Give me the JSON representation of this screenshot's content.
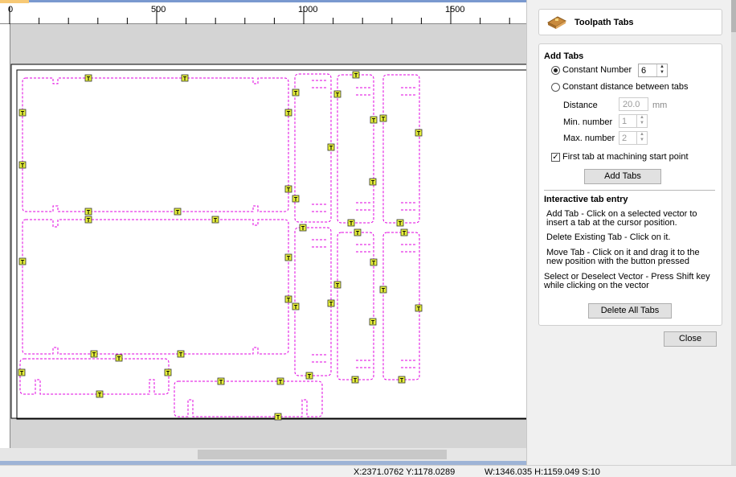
{
  "ruler": {
    "labels": [
      "0",
      "500",
      "1000",
      "1500"
    ]
  },
  "panel": {
    "title": "Toolpath Tabs",
    "add_tabs": {
      "heading": "Add Tabs",
      "constant_number_label": "Constant Number",
      "constant_number_value": "6",
      "constant_distance_label": "Constant distance between tabs",
      "distance_label": "Distance",
      "distance_value": "20.0",
      "distance_unit": "mm",
      "min_label": "Min. number",
      "min_value": "1",
      "max_label": "Max. number",
      "max_value": "2",
      "first_tab_label": "First tab at machining start point",
      "add_button": "Add Tabs"
    },
    "interactive": {
      "heading": "Interactive tab entry",
      "add_line1": "Add Tab - Click on a selected vector to",
      "add_line2": "insert a tab at the cursor position.",
      "delete_line": "Delete Existing Tab - Click on it.",
      "move_line1": "Move Tab - Click on it and drag it to the",
      "move_line2": "new position with the button pressed",
      "select_line1": "Select or Deselect Vector - Press Shift key",
      "select_line2": "while clicking on the vector",
      "delete_all_button": "Delete All Tabs"
    },
    "close_button": "Close"
  },
  "status": {
    "coords": "X:2371.0762 Y:1178.0289",
    "dims": "W:1346.035  H:1159.049  S:10"
  },
  "tab_glyph": "T",
  "colors": {
    "vector": "#e000e0",
    "tab_fill": "#e6f03a",
    "selection_blue": "#7a99cf"
  }
}
